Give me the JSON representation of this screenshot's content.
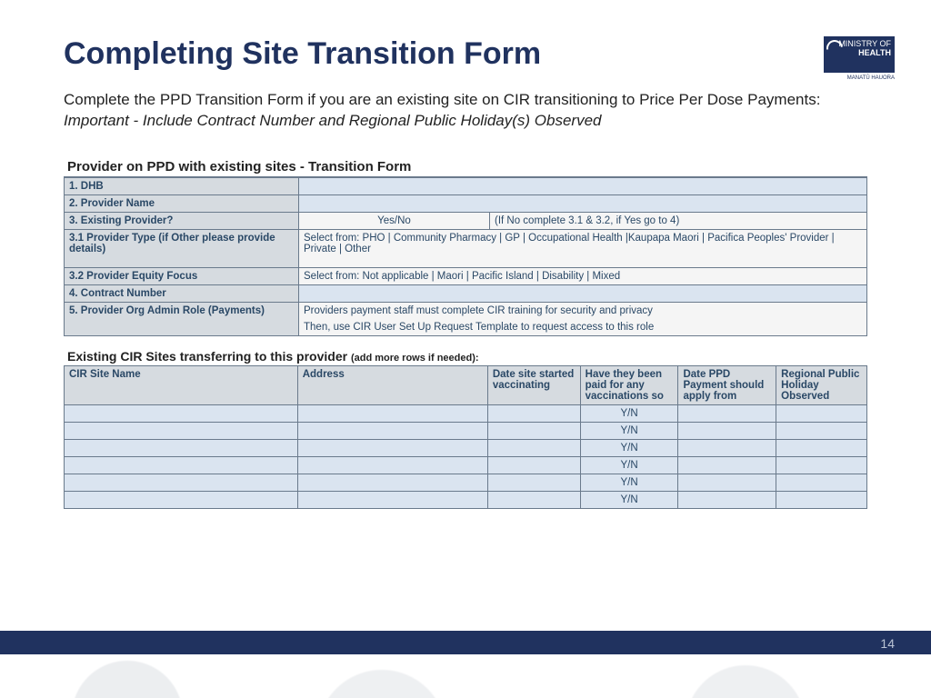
{
  "logo": {
    "line1": "MINISTRY OF",
    "line2": "HEALTH",
    "sub": "MANATŪ HAUORA"
  },
  "title": "Completing Site Transition Form",
  "intro_plain": "Complete the PPD Transition Form if you are an existing site on CIR transitioning to Price Per Dose Payments: ",
  "intro_italic": "Important - Include Contract Number and Regional Public Holiday(s) Observed",
  "form_title": "Provider on PPD with existing sites - Transition Form",
  "rows": {
    "r1": {
      "label": "1. DHB"
    },
    "r2": {
      "label": "2. Provider Name"
    },
    "r3": {
      "label": "3. Existing Provider?",
      "mid": "Yes/No",
      "right": "(If No complete 3.1 & 3.2, if Yes go to 4)"
    },
    "r31": {
      "label": "3.1 Provider Type (if Other please provide details)",
      "value": "Select from: PHO | Community Pharmacy | GP | Occupational Health |Kaupapa Maori | Pacifica Peoples' Provider | Private | Other"
    },
    "r32": {
      "label": "3.2 Provider Equity Focus",
      "value": "Select from: Not applicable | Maori | Pacific Island | Disability | Mixed"
    },
    "r4": {
      "label": "4. Contract Number"
    },
    "r5": {
      "label": "5. Provider Org Admin Role (Payments)",
      "line1": "Providers payment staff must complete CIR training for security and privacy",
      "line2": "Then, use CIR User Set Up Request Template to request access to this role"
    }
  },
  "section2_title": "Existing CIR Sites transferring to this provider ",
  "section2_note": "(add more rows if needed):",
  "sites_headers": {
    "c1": "CIR Site Name",
    "c2": "Address",
    "c3": "Date site started vaccinating",
    "c4": "Have they been paid for any vaccinations so",
    "c5": "Date PPD Payment should apply from",
    "c6": "Regional Public Holiday Observed"
  },
  "yn": "Y/N",
  "site_row_count": 6,
  "page_number": "14"
}
